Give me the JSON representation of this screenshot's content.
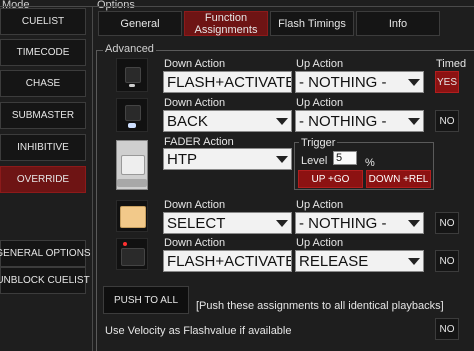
{
  "mode_panel": {
    "title": "Mode",
    "items": [
      "CUELIST",
      "TIMECODE",
      "CHASE",
      "SUBMASTER",
      "INHIBITIVE",
      "OVERRIDE"
    ],
    "active_item": "OVERRIDE",
    "general_options": "GENERAL OPTIONS",
    "unblock_cuelist": "UNBLOCK CUELIST"
  },
  "options": {
    "title": "Options",
    "tabs": [
      "General",
      "Function Assignments",
      "Flash Timings",
      "Info"
    ],
    "tab_lines": {
      "general": "General",
      "func_1": "Function",
      "func_2": "Assignments",
      "flash": "Flash Timings",
      "info": "Info"
    },
    "active_tab": "Function Assignments"
  },
  "advanced": {
    "title": "Advanced",
    "timed_label": "Timed",
    "rows": [
      {
        "down_label": "Down Action",
        "down_value": "FLASH+ACTIVATE",
        "up_label": "Up Action",
        "up_value": "- NOTHING -",
        "toggle": "YES",
        "toggle_on": true
      },
      {
        "down_label": "Down Action",
        "down_value": "BACK",
        "up_label": "Up Action",
        "up_value": "- NOTHING -",
        "toggle": "NO",
        "toggle_on": false
      },
      {
        "down_label": "Down Action",
        "down_value": "SELECT",
        "up_label": "Up Action",
        "up_value": "- NOTHING -",
        "toggle": "NO",
        "toggle_on": false
      },
      {
        "down_label": "Down Action",
        "down_value": "FLASH+ACTIVATE",
        "up_label": "Up Action",
        "up_value": "RELEASE",
        "toggle": "NO",
        "toggle_on": false
      }
    ],
    "fader": {
      "label": "FADER Action",
      "value": "HTP",
      "trigger_title": "Trigger",
      "level_label": "Level",
      "level_value": "5",
      "unit": "%",
      "up_button": "UP +GO",
      "down_button": "DOWN +REL"
    },
    "push_all": "PUSH TO ALL",
    "push_hint": "[Push these assignments to all identical playbacks]",
    "velocity_label": "Use Velocity as Flashvalue if available",
    "velocity_toggle": "NO"
  },
  "colors": {
    "active_red": "#6e1414",
    "toggle_red": "#8c1212",
    "background": "#1e1e1e"
  }
}
